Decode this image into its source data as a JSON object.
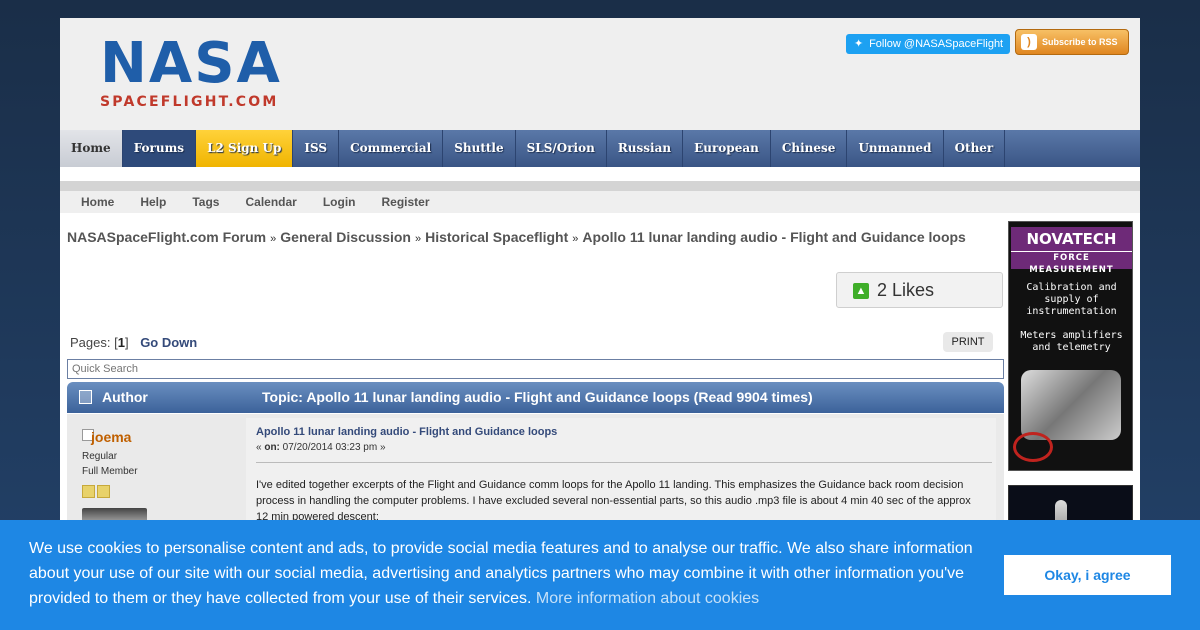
{
  "header": {
    "logo_main": "NASA",
    "logo_sub": "SPACEFLIGHT.COM",
    "twitter_label": "Follow @NASASpaceFlight",
    "rss_label": "Subscribe to RSS"
  },
  "nav": {
    "items": [
      "Home",
      "Forums",
      "L2 Sign Up",
      "ISS",
      "Commercial",
      "Shuttle",
      "SLS/Orion",
      "Russian",
      "European",
      "Chinese",
      "Unmanned",
      "Other"
    ]
  },
  "subnav": {
    "items": [
      "Home",
      "Help",
      "Tags",
      "Calendar",
      "Login",
      "Register"
    ]
  },
  "breadcrumb": {
    "items": [
      "NASASpaceFlight.com Forum",
      "General Discussion",
      "Historical Spaceflight",
      "Apollo 11 lunar landing audio - Flight and Guidance loops"
    ],
    "separator": "»"
  },
  "likes": {
    "label": "2 Likes"
  },
  "pagination": {
    "prefix": "Pages: [",
    "current": "1",
    "suffix": "]",
    "go_down": "Go Down"
  },
  "print_label": "PRINT",
  "quick_search": {
    "placeholder": "Quick Search"
  },
  "topic_header": {
    "author": "Author",
    "topic": "Topic: Apollo 11 lunar landing audio - Flight and Guidance loops  (Read 9904 times)"
  },
  "post": {
    "poster": "joema",
    "rank": "Regular",
    "group": "Full Member",
    "subject": "Apollo 11 lunar landing audio - Flight and Guidance loops",
    "date_prefix": "« ",
    "date_label": "on:",
    "date": " 07/20/2014 03:23 pm »",
    "body": "I've edited together excerpts of the Flight and Guidance comm loops for the Apollo 11 landing. This emphasizes the Guidance back room decision process in handling the computer problems. I have excluded several non-essential parts, so this audio .mp3 file is about 4 min 40 sec of the approx 12 min powered descent:"
  },
  "ads": {
    "ad1": {
      "brand": "NOVATECH",
      "tagline": "FORCE MEASUREMENT",
      "text1": "Calibration and supply of instrumentation",
      "text2": "Meters amplifiers and telemetry"
    }
  },
  "cookie": {
    "text": "We use cookies to personalise content and ads, to provide social media features and to analyse our traffic. We also share information about your use of our site with our social media, advertising and analytics partners who may combine it with other information you've provided to them or they have collected from your use of their services.",
    "link": "More information about cookies",
    "button": "Okay, i agree"
  }
}
